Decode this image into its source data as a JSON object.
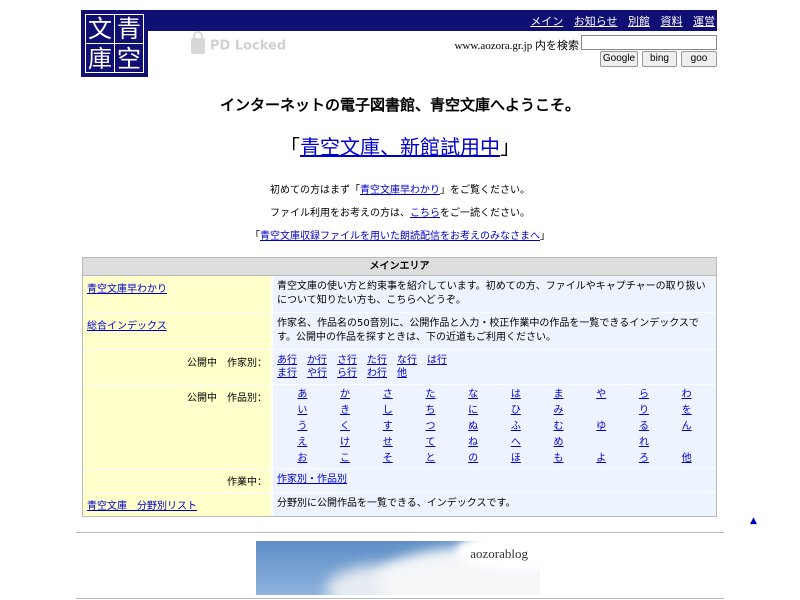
{
  "logo": {
    "c1": "文",
    "c2": "青",
    "c3": "庫",
    "c4": "空"
  },
  "nav": [
    "メイン",
    "お知らせ",
    "別館",
    "資料",
    "運営"
  ],
  "pd_locked": "PD Locked",
  "search": {
    "label": "www.aozora.gr.jp 内を検索",
    "buttons": [
      "Google",
      "bing",
      "goo"
    ]
  },
  "welcome": "インターネットの電子図書館、青空文庫へようこそ。",
  "newsite": {
    "open": "「",
    "link": "青空文庫、新館試用中",
    "close": "」"
  },
  "intro1": {
    "pre": "初めての方はまず「",
    "link": "青空文庫早わかり",
    "post": "」をご覧ください。"
  },
  "intro2": {
    "pre": "ファイル利用をお考えの方は、",
    "link": "こちら",
    "post": "をご一読ください。"
  },
  "intro3": {
    "pre": "「",
    "link": "青空文庫収録ファイルを用いた朗読配信をお考えのみなさまへ",
    "post": "」"
  },
  "main": {
    "title": "メインエリア",
    "quick": {
      "link": "青空文庫早わかり",
      "desc": "青空文庫の使い方と約束事を紹介しています。初めての方、ファイルやキャプチャーの取り扱いについて知りたい方も、こちらへどうぞ。"
    },
    "index": {
      "link": "総合インデックス",
      "desc": "作家名、作品名の50音別に、公開作品と入力・校正作業中の作品を一覧できるインデックスです。公開中の作品を探すときは、下の近道もご利用ください。"
    },
    "authors": {
      "label": "公開中　作家別：",
      "row1": [
        "あ行",
        "か行",
        "さ行",
        "た行",
        "な行",
        "は行"
      ],
      "row2": [
        "ま行",
        "や行",
        "ら行",
        "わ行",
        "他"
      ]
    },
    "works": {
      "label": "公開中　作品別：",
      "kana": [
        "あ",
        "か",
        "さ",
        "た",
        "な",
        "は",
        "ま",
        "や",
        "ら",
        "わ",
        "い",
        "き",
        "し",
        "ち",
        "に",
        "ひ",
        "み",
        "",
        "り",
        "を",
        "う",
        "く",
        "す",
        "つ",
        "ぬ",
        "ふ",
        "む",
        "ゆ",
        "る",
        "ん",
        "え",
        "け",
        "せ",
        "て",
        "ね",
        "へ",
        "め",
        "",
        "れ",
        "",
        "お",
        "こ",
        "そ",
        "と",
        "の",
        "ほ",
        "も",
        "よ",
        "ろ",
        "他"
      ]
    },
    "inprogress": {
      "label": "作業中：",
      "link": "作家別・作品別"
    },
    "genre": {
      "link": "青空文庫　分野別リスト",
      "desc": "分野別に公開作品を一覧できる、インデックスです。"
    }
  },
  "pagetop": "▲",
  "blog": "aozorablog"
}
